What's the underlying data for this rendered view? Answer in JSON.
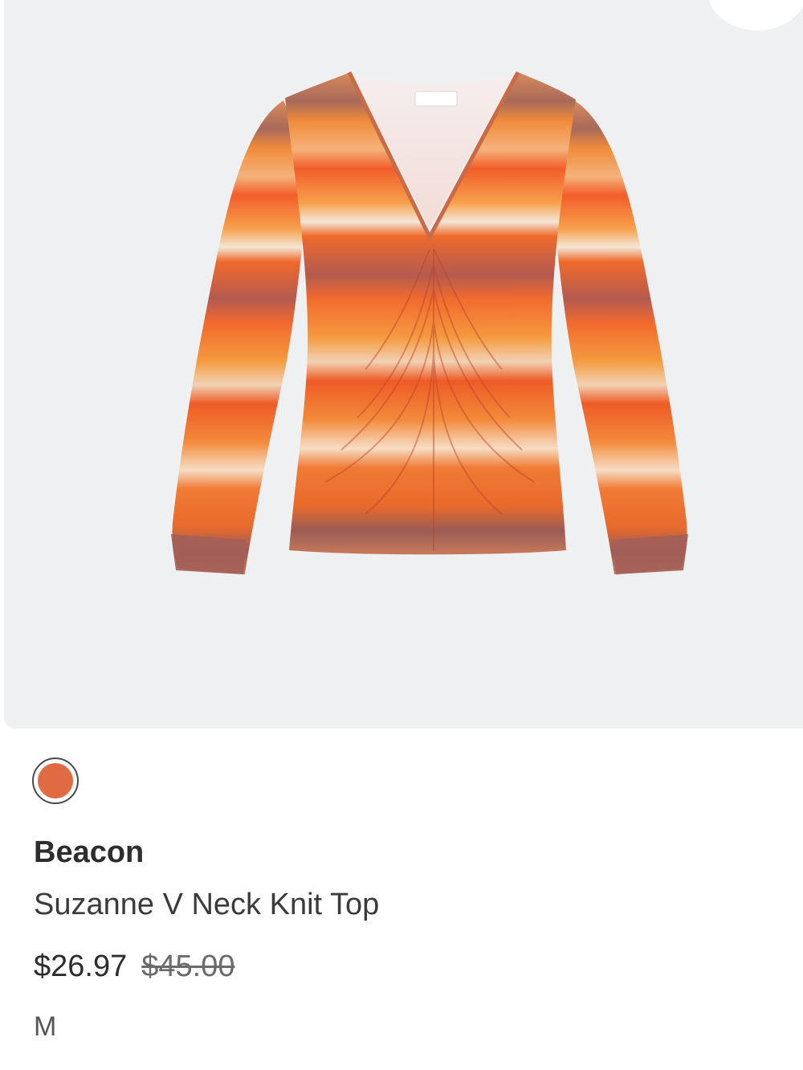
{
  "product": {
    "brand": "Beacon",
    "name": "Suzanne V Neck Knit Top",
    "sale_price": "$26.97",
    "original_price": "$45.00",
    "size": "M",
    "color_swatch": "#e06a42",
    "image_icon": "orange-striped-top-image"
  },
  "colors": {
    "panel_bg": "#eff0f2",
    "text": "#2d2d2d",
    "muted": "#6b6b6b"
  }
}
